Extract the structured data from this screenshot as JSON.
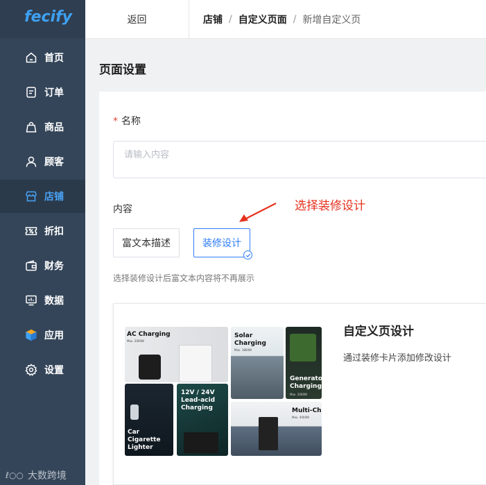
{
  "brand": {
    "logo_text": "fecify",
    "logo_color": "#3ea1f3"
  },
  "sidebar": {
    "items": [
      {
        "label": "首页",
        "icon": "home-icon",
        "active": false
      },
      {
        "label": "订单",
        "icon": "order-icon",
        "active": false
      },
      {
        "label": "商品",
        "icon": "bag-icon",
        "active": false
      },
      {
        "label": "顾客",
        "icon": "user-icon",
        "active": false
      },
      {
        "label": "店铺",
        "icon": "store-icon",
        "active": true
      },
      {
        "label": "折扣",
        "icon": "discount-icon",
        "active": false
      },
      {
        "label": "财务",
        "icon": "wallet-icon",
        "active": false
      },
      {
        "label": "数据",
        "icon": "chart-icon",
        "active": false
      },
      {
        "label": "应用",
        "icon": "box-icon",
        "active": false
      },
      {
        "label": "设置",
        "icon": "gear-icon",
        "active": false
      }
    ],
    "watermark": "大数跨境"
  },
  "topbar": {
    "back_label": "返回",
    "breadcrumb": [
      "店铺",
      "自定义页面",
      "新增自定义页"
    ],
    "separator": "/"
  },
  "page": {
    "title": "页面设置"
  },
  "form": {
    "name_label": "名称",
    "required_mark": "*",
    "name_placeholder": "请输入内容",
    "content_label": "内容",
    "options": [
      {
        "label": "富文本描述",
        "selected": false
      },
      {
        "label": "装修设计",
        "selected": true
      }
    ],
    "hint": "选择装修设计后富文本内容将不再展示"
  },
  "annotation": {
    "text": "选择装修设计",
    "color": "#e5311e"
  },
  "design_card": {
    "title": "自定义页设计",
    "description": "通过装修卡片添加修改设计",
    "thumbnails": [
      {
        "title": "AC Charging",
        "sub": "Max. 2000W"
      },
      {
        "title": "Solar Charging",
        "sub": "Max. 1800W"
      },
      {
        "title": "Generator Charging",
        "sub": "Max. 2000W"
      },
      {
        "title": "Car Cigarette Lighter",
        "sub": ""
      },
      {
        "title": "12V / 24V Lead-acid Charging",
        "sub": ""
      },
      {
        "title": "Multi-Cha",
        "sub": "Max. 4000W"
      }
    ]
  },
  "colors": {
    "sidebar_bg": "#344559",
    "active_text": "#4aa3f5",
    "accent": "#2f7df6",
    "required": "#e0483a"
  }
}
